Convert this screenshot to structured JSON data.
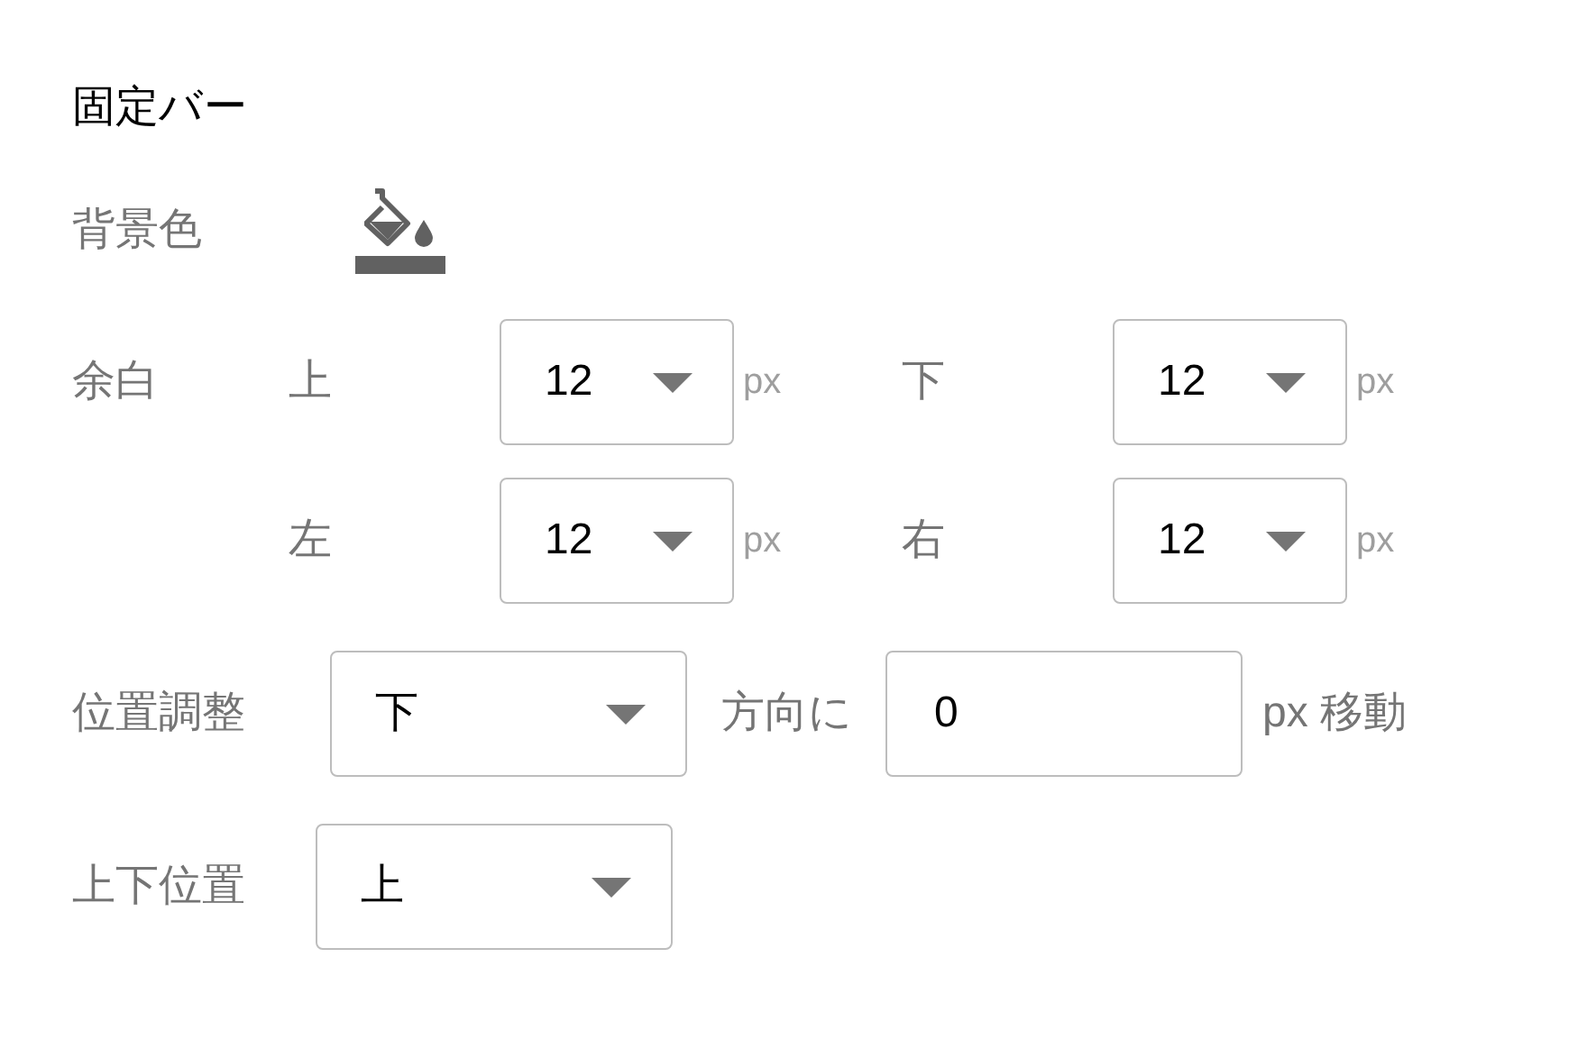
{
  "title": "固定バー",
  "background_color": {
    "label": "背景色"
  },
  "margin": {
    "label": "余白",
    "fields": [
      {
        "side": "上",
        "value": "12",
        "unit": "px"
      },
      {
        "side": "下",
        "value": "12",
        "unit": "px"
      },
      {
        "side": "左",
        "value": "12",
        "unit": "px"
      },
      {
        "side": "右",
        "value": "12",
        "unit": "px"
      }
    ]
  },
  "offset": {
    "label": "位置調整",
    "direction": "下",
    "middle": "方向に",
    "value": "0",
    "suffix": "px 移動"
  },
  "vertical_position": {
    "label": "上下位置",
    "value": "上"
  }
}
